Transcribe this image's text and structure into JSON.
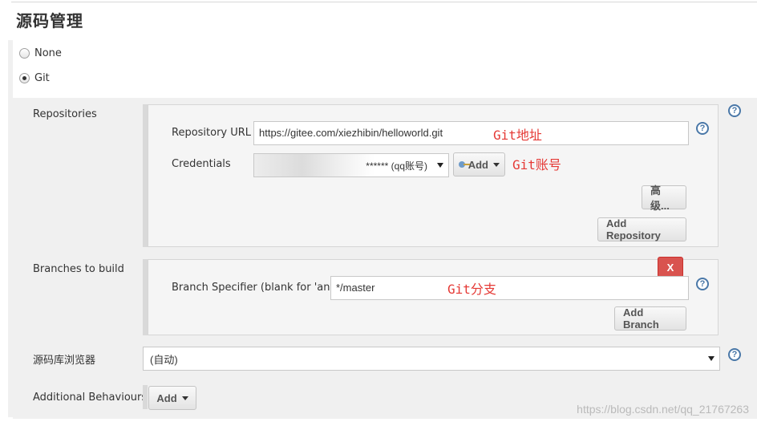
{
  "section": {
    "title": "源码管理"
  },
  "scm_options": [
    {
      "label": "None",
      "checked": false
    },
    {
      "label": "Git",
      "checked": true
    }
  ],
  "repositories": {
    "label": "Repositories",
    "url_label": "Repository URL",
    "url_value": "https://gitee.com/xiezhibin/helloworld.git",
    "url_annotation": "Git地址",
    "credentials_label": "Credentials",
    "credentials_value": "****** (qq账号)",
    "credentials_annotation": "Git账号",
    "add_label": "Add",
    "advanced_label": "高级...",
    "add_repository_label": "Add Repository"
  },
  "branches": {
    "label": "Branches to build",
    "delete_label": "X",
    "specifier_label": "Branch Specifier (blank for 'any')",
    "specifier_value": "*/master",
    "specifier_annotation": "Git分支",
    "add_branch_label": "Add Branch"
  },
  "browser": {
    "label": "源码库浏览器",
    "selected": "(自动)"
  },
  "behaviours": {
    "label": "Additional Behaviours",
    "add_label": "Add"
  },
  "help_label": "?",
  "watermark": "https://blog.csdn.net/qq_21767263",
  "colors": {
    "annotation": "#e53935",
    "delete_button": "#d9534f",
    "help_icon": "#4a78a8"
  }
}
